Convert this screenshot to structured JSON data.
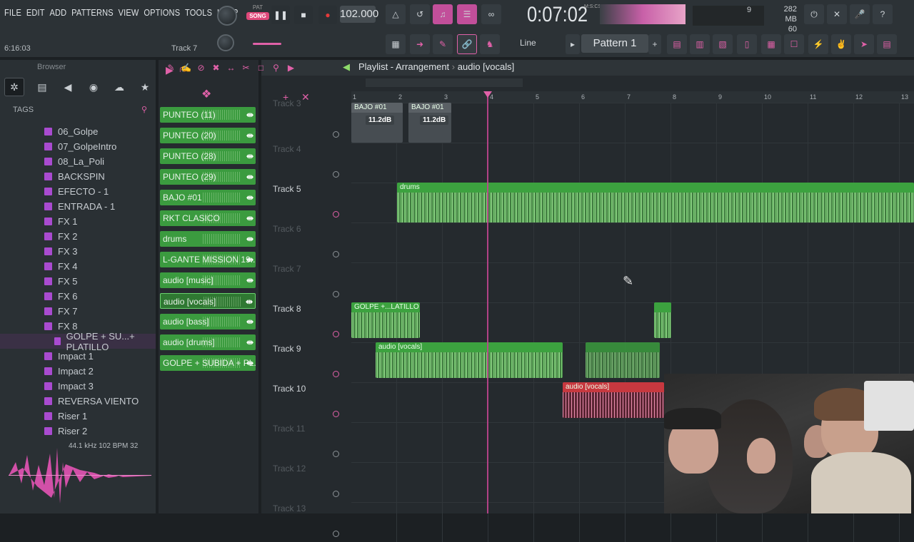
{
  "menu": [
    "FILE",
    "EDIT",
    "ADD",
    "PATTERNS",
    "VIEW",
    "OPTIONS",
    "TOOLS",
    "HELP"
  ],
  "transport": {
    "pat_label": "PAT",
    "song_label": "SONG",
    "bpm": "102.000",
    "time": "0:07:02",
    "time_unit": "M:S:CS"
  },
  "cpu": {
    "mem": "282 MB",
    "poly": "60",
    "voices": "9"
  },
  "hint_left": "6:16:03",
  "hint_track": "Track 7",
  "toolbar": {
    "line_label": "Line",
    "pattern_label": "Pattern 1",
    "pattern_add": "+"
  },
  "browser": {
    "title": "Browser",
    "tags_label": "TAGS",
    "items": [
      "06_Golpe",
      "07_GolpeIntro",
      "08_La_Poli",
      "BACKSPIN",
      "EFECTO - 1",
      "ENTRADA - 1",
      "FX 1",
      "FX 2",
      "FX 3",
      "FX 4",
      "FX 5",
      "FX 6",
      "FX 7",
      "FX 8",
      "GOLPE + SU...+ PLATILLO",
      "Impact 1",
      "Impact 2",
      "Impact 3",
      "REVERSA VIENTO",
      "Riser 1",
      "Riser 2"
    ],
    "selected_index": 14,
    "sample_info": "44.1 kHz 102 BPM 32"
  },
  "channels": [
    "PUNTEO (11)",
    "PUNTEO (20)",
    "PUNTEO (28)",
    "PUNTEO (29)",
    "BAJO #01",
    "RKT CLASICO",
    "drums",
    "L-GANTE MISSION 19...",
    "audio [music]",
    "audio [vocals]",
    "audio [bass]",
    "audio [drums]",
    "GOLPE + SUBIDA + PL..."
  ],
  "selected_channel": 9,
  "playlist": {
    "title": "Playlist - Arrangement",
    "crumb": "audio [vocals]",
    "ruler": [
      "1",
      "2",
      "3",
      "4",
      "5",
      "6",
      "7",
      "8",
      "9",
      "10",
      "11",
      "12",
      "13"
    ],
    "tracks": [
      "Track 3",
      "Track 4",
      "Track 5",
      "Track 6",
      "Track 7",
      "Track 8",
      "Track 9",
      "Track 10",
      "Track 11",
      "Track 12",
      "Track 13"
    ],
    "clips": {
      "bajo1": "BAJO #01",
      "bajo2": "BAJO #01",
      "db1": "11.2dB",
      "db2": "11.2dB",
      "drums": "drums",
      "golpe": "GOLPE +...LATILLO",
      "vocals": "audio [vocals]",
      "vocals_red": "audio [vocals]"
    }
  },
  "colors": {
    "accent": "#e061a8",
    "clip_green": "#3ca23f",
    "clip_red": "#c7383f",
    "playhead": "#c0448f"
  }
}
